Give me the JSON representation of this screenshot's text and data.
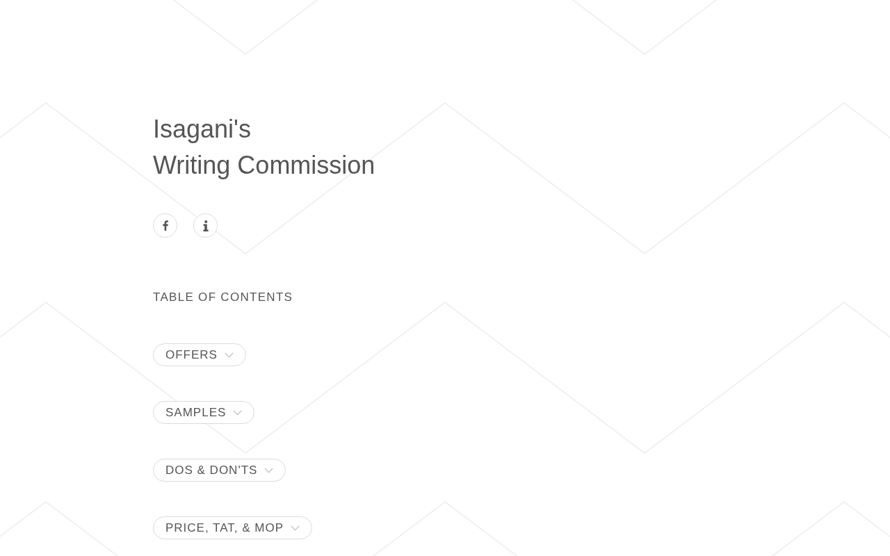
{
  "header": {
    "title_lines": [
      "Isagani's",
      "Writing Commission"
    ]
  },
  "table_of_contents": {
    "heading": "TABLE OF CONTENTS",
    "sections": [
      {
        "label": "OFFERS",
        "expanded": false
      },
      {
        "label": "SAMPLES",
        "expanded": false
      },
      {
        "label": "DOS & DON'TS",
        "expanded": false
      },
      {
        "label": "PRICE, TAT, & MOP",
        "expanded": false
      }
    ]
  }
}
